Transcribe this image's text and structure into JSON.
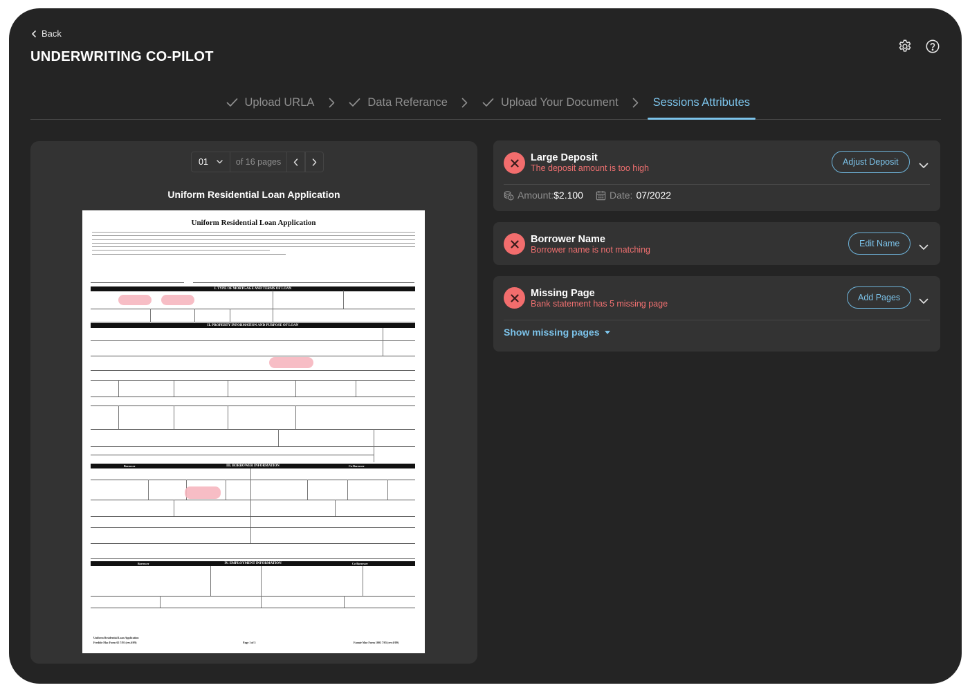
{
  "header": {
    "back_label": "Back",
    "title": "UNDERWRITING CO-PILOT",
    "icons": [
      "gear-icon",
      "help-icon"
    ]
  },
  "steps": [
    {
      "label": "Upload URLA",
      "state": "done"
    },
    {
      "label": "Data Referance",
      "state": "done"
    },
    {
      "label": "Upload Your Document",
      "state": "done"
    },
    {
      "label": "Sessions Attributes",
      "state": "active"
    }
  ],
  "viewer": {
    "page_select": "01",
    "of_pages": "of 16 pages",
    "doc_title": "Uniform Residential Loan Application",
    "paper": {
      "title": "Uniform Residential Loan Application",
      "sections": [
        "I. TYPE OF MORTGAGE AND TERMS OF LOAN",
        "II. PROPERTY INFORMATION AND PURPOSE OF LOAN",
        "III. BORROWER INFORMATION",
        "IV. EMPLOYMENT INFORMATION"
      ],
      "side_borrower": "Borrower",
      "side_coborrower": "Co-Borrower",
      "footer_left_1": "Uniform Residential Loan Application",
      "footer_left_2": "Freddie Mac Form 65   7/05 (rev.6/09)",
      "footer_center": "Page 1 of 5",
      "footer_right": "Fannie Mae Form 1003   7/05 (rev.6/09)"
    }
  },
  "issues": [
    {
      "title": "Large Deposit",
      "subtitle": "The deposit amount is too high",
      "button": "Adjust Deposit",
      "amount_label": "Amount:",
      "amount_value": "$2.100",
      "date_label": "Date:",
      "date_value": "07/2022"
    },
    {
      "title": "Borrower Name",
      "subtitle": "Borrower name is not matching",
      "button": "Edit Name"
    },
    {
      "title": "Missing Page",
      "subtitle": "Bank statement has 5 missing page",
      "button": "Add Pages",
      "link": "Show missing pages"
    }
  ],
  "colors": {
    "background": "#242424",
    "panel": "#333333",
    "accent": "#7cc3ea",
    "error": "#f26d6d"
  }
}
